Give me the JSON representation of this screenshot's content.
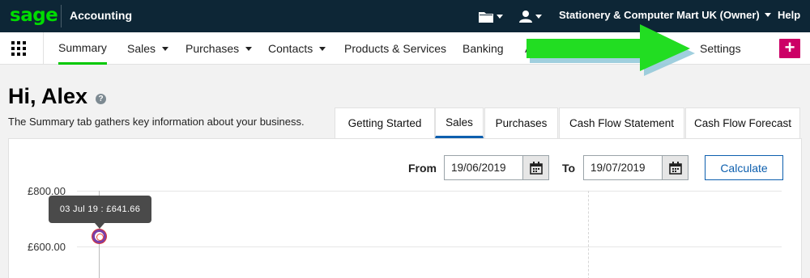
{
  "topbar": {
    "logo": "sage",
    "app_name": "Accounting",
    "folder_icon": "folder-icon",
    "user_icon": "user-icon",
    "company": "Stationery & Computer Mart UK (Owner)",
    "help": "Help"
  },
  "nav": {
    "items": [
      {
        "label": "Summary",
        "active": true
      },
      {
        "label": "Sales",
        "dropdown": true
      },
      {
        "label": "Purchases",
        "dropdown": true
      },
      {
        "label": "Contacts",
        "dropdown": true
      },
      {
        "label": "Products & Services"
      },
      {
        "label": "Banking"
      },
      {
        "label": "Ad"
      },
      {
        "label": "Settings"
      }
    ],
    "plus": "+"
  },
  "colors": {
    "topbar_bg": "#0d2636",
    "brand_green": "#00dc00",
    "accent_blue": "#0d5fae",
    "plus_magenta": "#cc0066",
    "arrow_green": "#22dd22"
  },
  "page": {
    "greeting": "Hi, Alex",
    "help_icon": "?",
    "subtitle": "The Summary tab gathers key information about your business."
  },
  "tabs": [
    {
      "label": "Getting Started"
    },
    {
      "label": "Sales",
      "active": true
    },
    {
      "label": "Purchases"
    },
    {
      "label": "Cash Flow Statement"
    },
    {
      "label": "Cash Flow Forecast"
    }
  ],
  "filters": {
    "from_label": "From",
    "from_value": "19/06/2019",
    "to_label": "To",
    "to_value": "19/07/2019",
    "calculate": "Calculate"
  },
  "chart_data": {
    "type": "line",
    "y_ticks": [
      "£800.00",
      "£600.00"
    ],
    "tooltip": "03 Jul 19 :  £641.66",
    "points": [
      {
        "x": "03 Jul 19",
        "y": 641.66
      }
    ]
  }
}
